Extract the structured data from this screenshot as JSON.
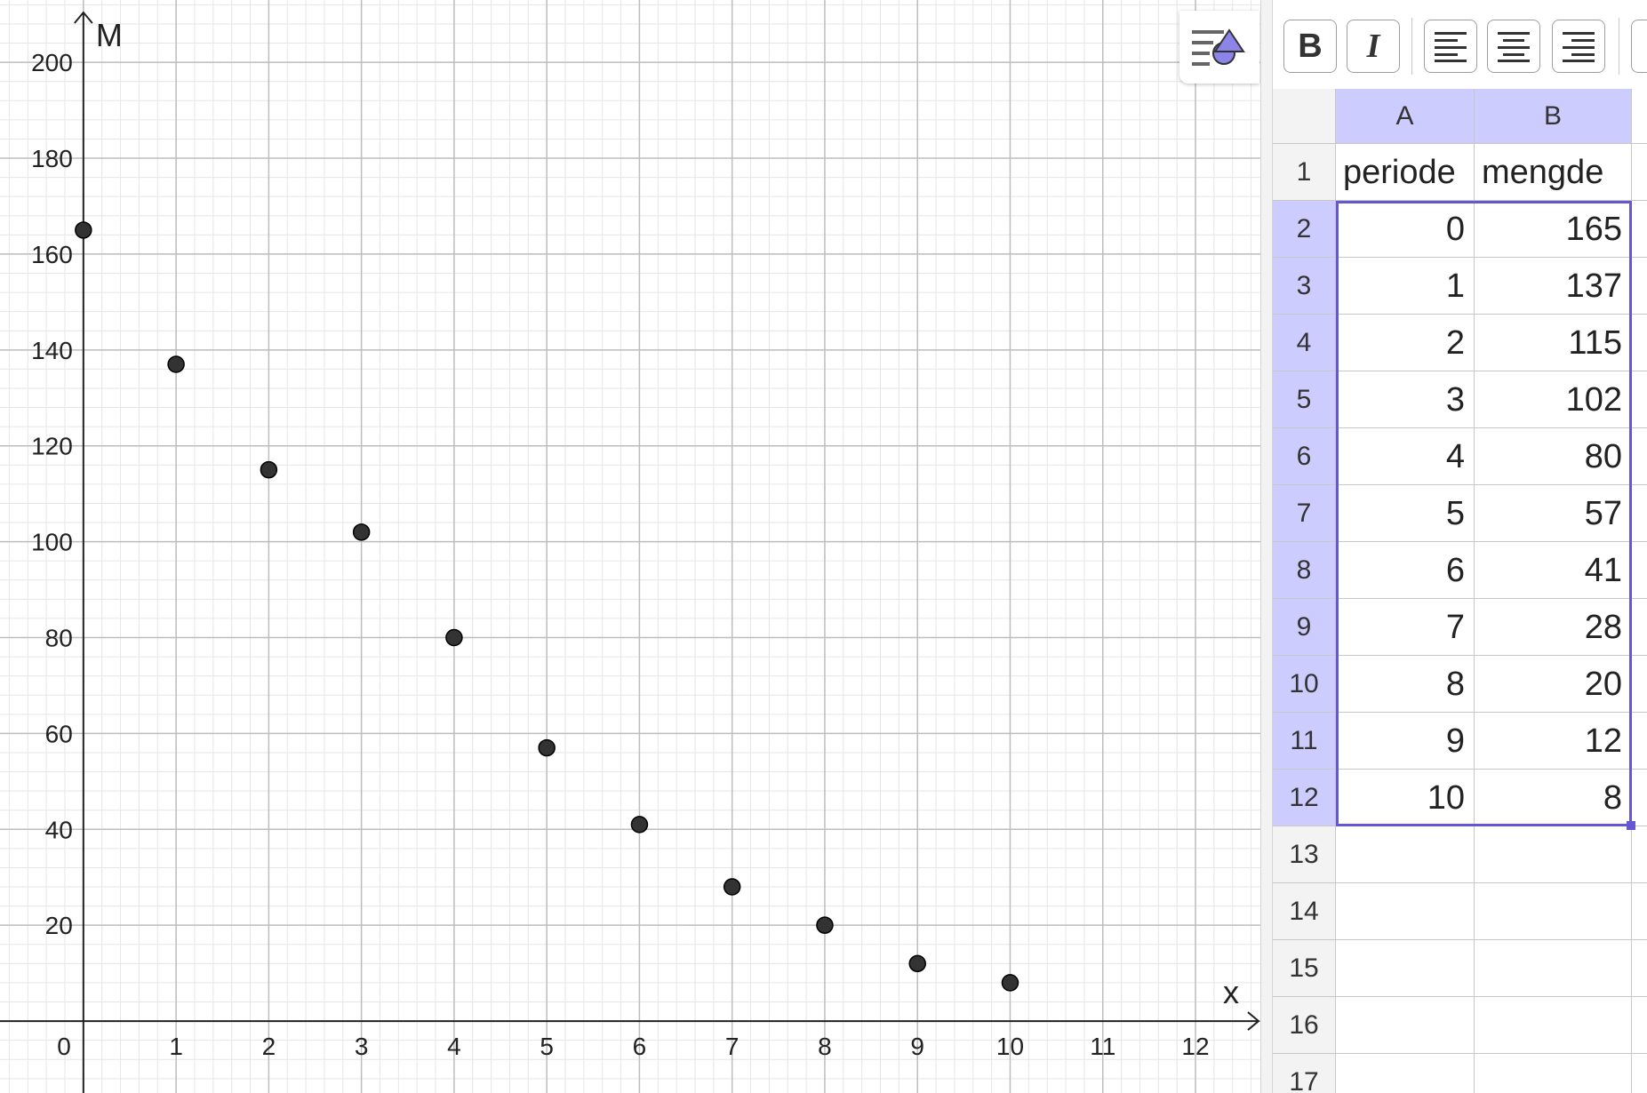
{
  "chart_data": {
    "type": "scatter",
    "xlabel": "x",
    "ylabel": "M",
    "xlim": [
      -0.9,
      12.7
    ],
    "ylim": [
      -15,
      213
    ],
    "grid": true,
    "x_ticks": [
      "1",
      "0",
      "1",
      "2",
      "3",
      "4",
      "5",
      "6",
      "7",
      "8",
      "9",
      "10",
      "11",
      "12"
    ],
    "y_ticks": [
      "20",
      "40",
      "60",
      "80",
      "100",
      "120",
      "140",
      "160",
      "180",
      "200"
    ],
    "x": [
      0,
      1,
      2,
      3,
      4,
      5,
      6,
      7,
      8,
      9,
      10
    ],
    "y": [
      165,
      137,
      115,
      102,
      80,
      57,
      41,
      28,
      20,
      12,
      8
    ],
    "point_color": "#333333"
  },
  "toolbar": {
    "bold_label": "B",
    "italic_label": "I"
  },
  "spreadsheet": {
    "columns": [
      "A",
      "B"
    ],
    "row_numbers": [
      "1",
      "2",
      "3",
      "4",
      "5",
      "6",
      "7",
      "8",
      "9",
      "10",
      "11",
      "12",
      "13",
      "14",
      "15",
      "16",
      "17"
    ],
    "header_row": [
      "periode",
      "mengde"
    ],
    "rows": [
      [
        "0",
        "165"
      ],
      [
        "1",
        "137"
      ],
      [
        "2",
        "115"
      ],
      [
        "3",
        "102"
      ],
      [
        "4",
        "80"
      ],
      [
        "5",
        "57"
      ],
      [
        "6",
        "41"
      ],
      [
        "7",
        "28"
      ],
      [
        "8",
        "20"
      ],
      [
        "9",
        "12"
      ],
      [
        "10",
        "8"
      ]
    ]
  },
  "colors": {
    "selection": "#6557d2",
    "header_highlight": "#ccccff"
  }
}
